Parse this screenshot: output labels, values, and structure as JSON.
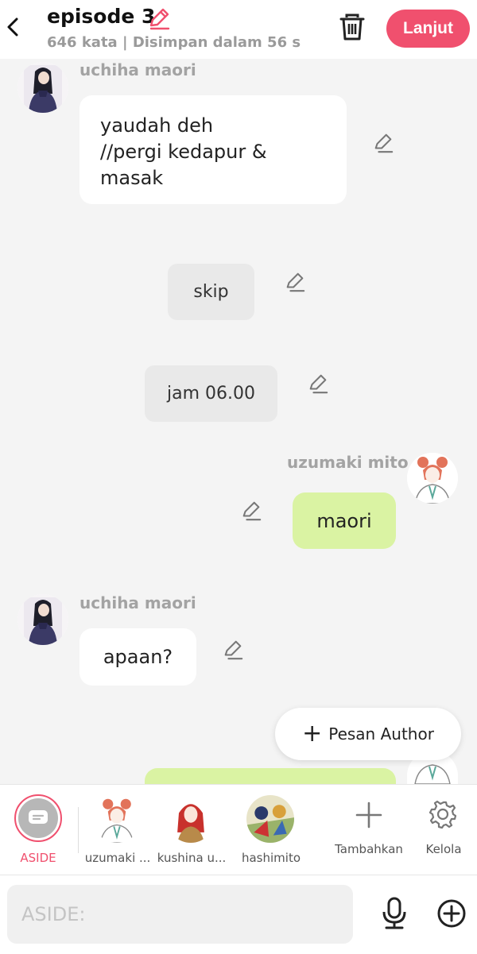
{
  "header": {
    "title": "episode 3",
    "subtitle": "646 kata | Disimpan dalam 56 s",
    "next_label": "Lanjut"
  },
  "messages": [
    {
      "speaker": "uchiha maori",
      "text": "yaudah deh\n//pergi kedapur &\nmasak",
      "side": "left"
    },
    {
      "text": "skip",
      "type": "narration"
    },
    {
      "text": "jam 06.00",
      "type": "narration"
    },
    {
      "speaker": "uzumaki mito",
      "text": "maori",
      "side": "right"
    },
    {
      "speaker": "uchiha maori",
      "text": "apaan?",
      "side": "left"
    }
  ],
  "author_button": {
    "label": "Pesan Author"
  },
  "characters": [
    {
      "label": "ASIDE",
      "active": true
    },
    {
      "label": "uzumaki ..."
    },
    {
      "label": "kushina u..."
    },
    {
      "label": "hashimito"
    }
  ],
  "actions": {
    "add_label": "Tambahkan",
    "manage_label": "Kelola"
  },
  "input": {
    "placeholder": "ASIDE:"
  },
  "colors": {
    "accent": "#f0506e",
    "green_bubble": "#daf3a3",
    "background": "#f4f4f4"
  },
  "icons": [
    "back-icon",
    "pencil-icon",
    "trash-icon",
    "plus-icon",
    "gear-icon",
    "microphone-icon",
    "plus-circle-icon"
  ]
}
